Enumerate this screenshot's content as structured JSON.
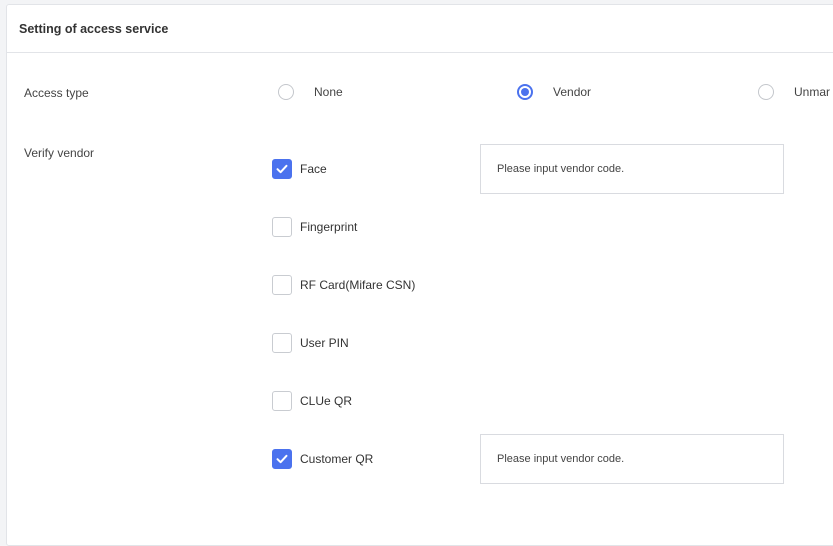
{
  "panel": {
    "title": "Setting of access service"
  },
  "access_type": {
    "label": "Access type",
    "options": [
      {
        "label": "None",
        "selected": false
      },
      {
        "label": "Vendor",
        "selected": true
      },
      {
        "label": "Unmar",
        "selected": false
      }
    ]
  },
  "verify_vendor": {
    "label": "Verify vendor",
    "options": [
      {
        "label": "Face",
        "checked": true,
        "input_placeholder": "Please input vendor code."
      },
      {
        "label": "Fingerprint",
        "checked": false
      },
      {
        "label": "RF Card(Mifare CSN)",
        "checked": false
      },
      {
        "label": "User PIN",
        "checked": false
      },
      {
        "label": "CLUe QR",
        "checked": false
      },
      {
        "label": "Customer QR",
        "checked": true,
        "input_placeholder": "Please input vendor code."
      }
    ]
  },
  "colors": {
    "accent": "#4b72ee",
    "border": "#e2e4e8",
    "background": "#f3f4f6"
  },
  "icons": {
    "check": "checkmark-icon"
  }
}
